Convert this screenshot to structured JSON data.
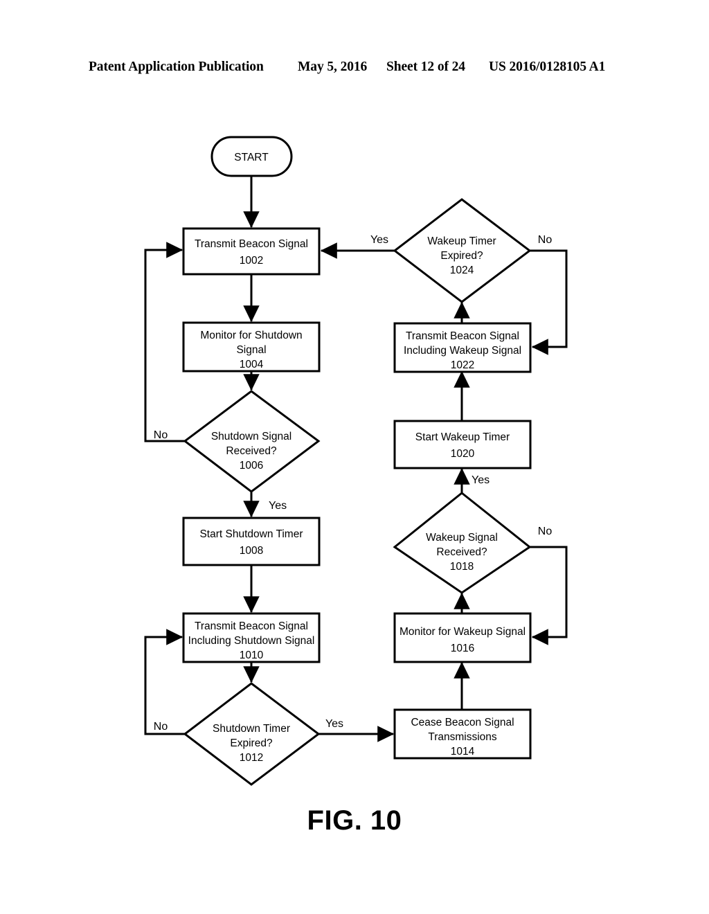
{
  "header": {
    "title": "Patent Application Publication",
    "date": "May 5, 2016",
    "sheet": "Sheet 12 of 24",
    "publication_number": "US 2016/0128105 A1"
  },
  "figure": {
    "caption": "FIG. 10",
    "type": "flowchart"
  },
  "nodes": [
    {
      "id": "start",
      "shape": "terminator",
      "lines": [
        "START"
      ],
      "ref": ""
    },
    {
      "id": "n1002",
      "shape": "process",
      "lines": [
        "Transmit Beacon Signal"
      ],
      "ref": "1002"
    },
    {
      "id": "n1004",
      "shape": "process",
      "lines": [
        "Monitor for Shutdown",
        "Signal"
      ],
      "ref": "1004"
    },
    {
      "id": "n1006",
      "shape": "decision",
      "lines": [
        "Shutdown Signal",
        "Received?"
      ],
      "ref": "1006"
    },
    {
      "id": "n1008",
      "shape": "process",
      "lines": [
        "Start Shutdown Timer"
      ],
      "ref": "1008"
    },
    {
      "id": "n1010",
      "shape": "process",
      "lines": [
        "Transmit Beacon Signal",
        "Including Shutdown Signal"
      ],
      "ref": "1010"
    },
    {
      "id": "n1012",
      "shape": "decision",
      "lines": [
        "Shutdown Timer",
        "Expired?"
      ],
      "ref": "1012"
    },
    {
      "id": "n1014",
      "shape": "process",
      "lines": [
        "Cease Beacon Signal",
        "Transmissions"
      ],
      "ref": "1014"
    },
    {
      "id": "n1016",
      "shape": "process",
      "lines": [
        "Monitor for Wakeup Signal"
      ],
      "ref": "1016"
    },
    {
      "id": "n1018",
      "shape": "decision",
      "lines": [
        "Wakeup Signal",
        "Received?"
      ],
      "ref": "1018"
    },
    {
      "id": "n1020",
      "shape": "process",
      "lines": [
        "Start Wakeup Timer"
      ],
      "ref": "1020"
    },
    {
      "id": "n1022",
      "shape": "process",
      "lines": [
        "Transmit Beacon Signal",
        "Including Wakeup Signal"
      ],
      "ref": "1022"
    },
    {
      "id": "n1024",
      "shape": "decision",
      "lines": [
        "Wakeup Timer",
        "Expired?"
      ],
      "ref": "1024"
    }
  ],
  "edge_labels": {
    "e1006_no": "No",
    "e1006_yes": "Yes",
    "e1012_no": "No",
    "e1012_yes": "Yes",
    "e1018_no": "No",
    "e1018_yes": "Yes",
    "e1024_yes": "Yes",
    "e1024_no": "No"
  },
  "edges": [
    {
      "from": "start",
      "to": "n1002",
      "label": ""
    },
    {
      "from": "n1002",
      "to": "n1004",
      "label": ""
    },
    {
      "from": "n1004",
      "to": "n1006",
      "label": ""
    },
    {
      "from": "n1006",
      "to": "n1002",
      "label": "No"
    },
    {
      "from": "n1006",
      "to": "n1008",
      "label": "Yes"
    },
    {
      "from": "n1008",
      "to": "n1010",
      "label": ""
    },
    {
      "from": "n1010",
      "to": "n1012",
      "label": ""
    },
    {
      "from": "n1012",
      "to": "n1010",
      "label": "No"
    },
    {
      "from": "n1012",
      "to": "n1014",
      "label": "Yes"
    },
    {
      "from": "n1014",
      "to": "n1016",
      "label": ""
    },
    {
      "from": "n1016",
      "to": "n1018",
      "label": ""
    },
    {
      "from": "n1018",
      "to": "n1016",
      "label": "No"
    },
    {
      "from": "n1018",
      "to": "n1020",
      "label": "Yes"
    },
    {
      "from": "n1020",
      "to": "n1022",
      "label": ""
    },
    {
      "from": "n1022",
      "to": "n1024",
      "label": ""
    },
    {
      "from": "n1024",
      "to": "n1022",
      "label": "No"
    },
    {
      "from": "n1024",
      "to": "n1002",
      "label": "Yes"
    }
  ],
  "colors": {
    "ink": "#000000",
    "paper": "#ffffff"
  }
}
